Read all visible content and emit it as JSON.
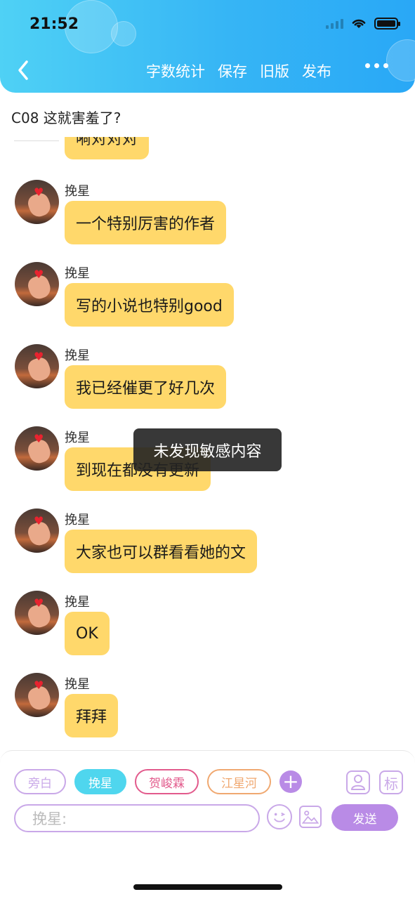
{
  "status_bar": {
    "time": "21:52"
  },
  "header": {
    "nav_items": [
      "字数统计",
      "保存",
      "旧版",
      "发布"
    ]
  },
  "chat": {
    "title": "C08 这就害羞了?",
    "partial_top_message": "嗬对对对",
    "messages": [
      {
        "sender": "挽星",
        "text": "一个特别厉害的作者"
      },
      {
        "sender": "挽星",
        "text": "写的小说也特别good"
      },
      {
        "sender": "挽星",
        "text": "我已经催更了好几次"
      },
      {
        "sender": "挽星",
        "text": "到现在都没有更新"
      },
      {
        "sender": "挽星",
        "text": "大家也可以群看看她的文"
      },
      {
        "sender": "挽星",
        "text": "OK"
      },
      {
        "sender": "挽星",
        "text": "拜拜"
      }
    ]
  },
  "toast": {
    "text": "未发现敏感内容"
  },
  "composer": {
    "roles": [
      {
        "label": "旁白",
        "style": "narration"
      },
      {
        "label": "挽星",
        "style": "active"
      },
      {
        "label": "贺峻霖",
        "style": "he"
      },
      {
        "label": "江星河",
        "style": "jiang"
      }
    ],
    "add_label": "+",
    "tag_label": "标",
    "placeholder": "挽星:",
    "send_label": "发送"
  },
  "colors": {
    "header_start": "#4fd1f5",
    "header_end": "#29a8f6",
    "bubble": "#ffd86b",
    "accent_purple": "#b98be6",
    "active_chip": "#4fd6ee"
  }
}
